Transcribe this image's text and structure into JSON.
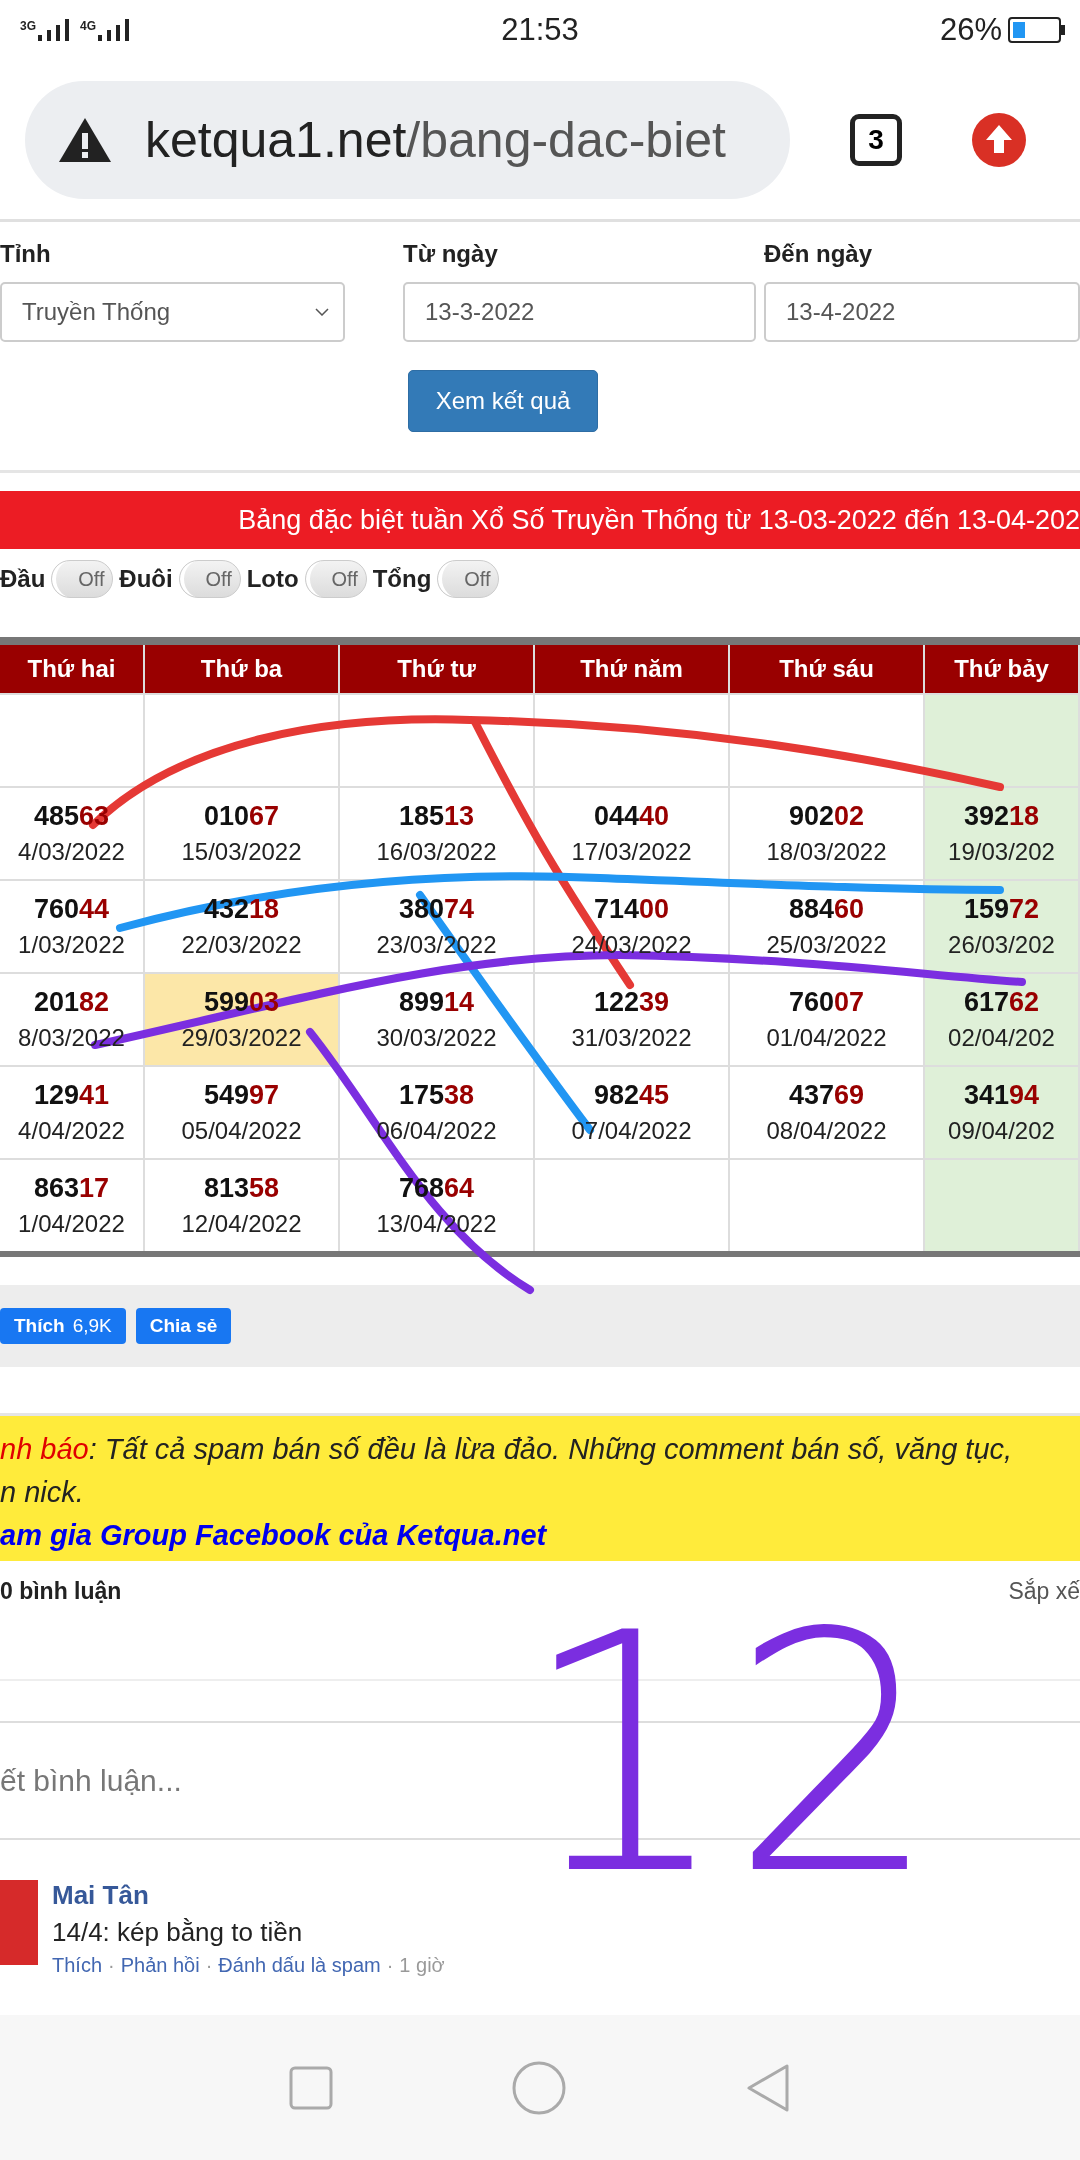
{
  "status_bar": {
    "network_1": "3G",
    "network_2": "4G",
    "time": "21:53",
    "battery": "26%"
  },
  "browser": {
    "url_host": "ketqua1.net",
    "url_path": "/bang-dac-biet",
    "tab_count": "3"
  },
  "filter": {
    "fields": [
      {
        "kind": "select",
        "label": "Tỉnh",
        "value": "Truyền Thống"
      },
      {
        "kind": "input",
        "label": "Từ ngày",
        "value": "13-3-2022"
      },
      {
        "kind": "input",
        "label": "Đến ngày",
        "value": "13-4-2022"
      }
    ],
    "submit": "Xem kết quả"
  },
  "banner": "Bảng đặc biệt tuần Xổ Số Truyền Thống từ 13-03-2022 đến 13-04-202",
  "toggles": [
    {
      "label": "Đầu",
      "state_label": "Off",
      "on": false
    },
    {
      "label": "Đuôi",
      "state_label": "Off",
      "on": false
    },
    {
      "label": "Loto",
      "state_label": "Off",
      "on": false
    },
    {
      "label": "Tổng",
      "state_label": "Off",
      "on": false
    }
  ],
  "table": {
    "columns": [
      {
        "label": "Thứ hai",
        "highlighted": false
      },
      {
        "label": "Thứ ba",
        "highlighted": false
      },
      {
        "label": "Thứ tư",
        "highlighted": false
      },
      {
        "label": "Thứ năm",
        "highlighted": false
      },
      {
        "label": "Thứ sáu",
        "highlighted": false
      },
      {
        "label": "Thứ bảy",
        "highlighted": true
      }
    ],
    "rows": [
      [
        null,
        null,
        null,
        null,
        null,
        null
      ],
      [
        {
          "head": "485",
          "tail": "63",
          "date": "4/03/2022",
          "highlighted": false
        },
        {
          "head": "010",
          "tail": "67",
          "date": "15/03/2022",
          "highlighted": false
        },
        {
          "head": "185",
          "tail": "13",
          "date": "16/03/2022",
          "highlighted": false
        },
        {
          "head": "044",
          "tail": "40",
          "date": "17/03/2022",
          "highlighted": false
        },
        {
          "head": "902",
          "tail": "02",
          "date": "18/03/2022",
          "highlighted": false
        },
        {
          "head": "392",
          "tail": "18",
          "date": "19/03/202",
          "highlighted": false
        }
      ],
      [
        {
          "head": "760",
          "tail": "44",
          "date": "1/03/2022",
          "highlighted": false
        },
        {
          "head": "432",
          "tail": "18",
          "date": "22/03/2022",
          "highlighted": false
        },
        {
          "head": "380",
          "tail": "74",
          "date": "23/03/2022",
          "highlighted": false
        },
        {
          "head": "714",
          "tail": "00",
          "date": "24/03/2022",
          "highlighted": false
        },
        {
          "head": "884",
          "tail": "60",
          "date": "25/03/2022",
          "highlighted": false
        },
        {
          "head": "159",
          "tail": "72",
          "date": "26/03/202",
          "highlighted": false
        }
      ],
      [
        {
          "head": "201",
          "tail": "82",
          "date": "8/03/2022",
          "highlighted": false
        },
        {
          "head": "599",
          "tail": "03",
          "date": "29/03/2022",
          "highlighted": true
        },
        {
          "head": "899",
          "tail": "14",
          "date": "30/03/2022",
          "highlighted": false
        },
        {
          "head": "122",
          "tail": "39",
          "date": "31/03/2022",
          "highlighted": false
        },
        {
          "head": "760",
          "tail": "07",
          "date": "01/04/2022",
          "highlighted": false
        },
        {
          "head": "617",
          "tail": "62",
          "date": "02/04/202",
          "highlighted": false
        }
      ],
      [
        {
          "head": "129",
          "tail": "41",
          "date": "4/04/2022",
          "highlighted": false
        },
        {
          "head": "549",
          "tail": "97",
          "date": "05/04/2022",
          "highlighted": false
        },
        {
          "head": "175",
          "tail": "38",
          "date": "06/04/2022",
          "highlighted": false
        },
        {
          "head": "982",
          "tail": "45",
          "date": "07/04/2022",
          "highlighted": false
        },
        {
          "head": "437",
          "tail": "69",
          "date": "08/04/2022",
          "highlighted": false
        },
        {
          "head": "341",
          "tail": "94",
          "date": "09/04/202",
          "highlighted": false
        }
      ],
      [
        {
          "head": "863",
          "tail": "17",
          "date": "1/04/2022",
          "highlighted": false
        },
        {
          "head": "813",
          "tail": "58",
          "date": "12/04/2022",
          "highlighted": false
        },
        {
          "head": "768",
          "tail": "64",
          "date": "13/04/2022",
          "highlighted": false
        },
        null,
        null,
        null
      ]
    ]
  },
  "social": {
    "like": "Thích",
    "like_count": "6,9K",
    "share": "Chia sẻ"
  },
  "notice": {
    "label": "nh báo",
    "text": ": Tất cả spam bán số đều là lừa đảo. Những comment bán số, văng tục,",
    "text_2": "n nick.",
    "link": "am gia Group Facebook của Ketqua.net"
  },
  "comments": {
    "count": "0 bình luận",
    "sort": "Sắp xế",
    "placeholder": "ết bình luận...",
    "items": [
      {
        "author": "Mai Tân",
        "text": "14/4: kép bằng to tiền",
        "actions": [
          "Thích",
          "Phản hồi",
          "Đánh dấu là spam"
        ],
        "separator": "·",
        "time": "1 giờ"
      }
    ]
  },
  "annotation": "12"
}
